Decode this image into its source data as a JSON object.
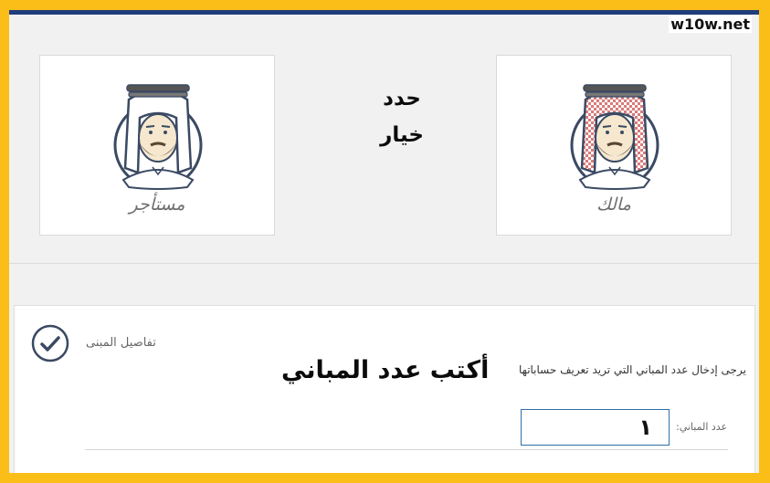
{
  "watermark": "w10w.net",
  "role_cards": {
    "tenant_label": "مستأجر",
    "owner_label": "مالك"
  },
  "annotations": {
    "choose_line1": "حدد",
    "choose_line2": "خيار",
    "write_count": "أكتب عدد المباني"
  },
  "building_details": {
    "section_title": "تفاصيل المبنى",
    "instruction": "يرجى إدخال عدد المباني التي تريد تعريف حساباتها",
    "field_label": "عدد المباني:",
    "field_value": "١"
  },
  "colors": {
    "frame": "#fbbd17",
    "top_bar": "#1f3d7a",
    "avatar_outline": "#3b4a63",
    "input_border": "#2f6fa8"
  }
}
